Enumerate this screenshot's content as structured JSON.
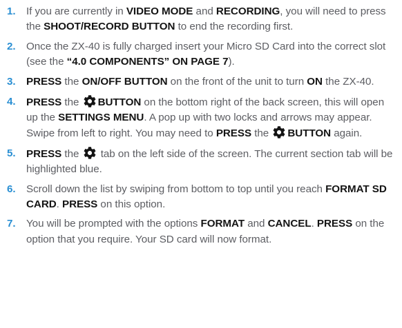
{
  "icons": {
    "settings": "gear-icon"
  },
  "colors": {
    "step_number": "#2a8fd3",
    "body_text": "#5c5d62",
    "bold_text": "#141414"
  },
  "steps": [
    {
      "num": "1.",
      "parts": [
        "If you are currently in ",
        "VIDEO MODE",
        " and ",
        "RECORDING",
        ", you will need to press the ",
        "SHOOT/RECORD BUTTON",
        " to end the recording first."
      ]
    },
    {
      "num": "2.",
      "parts": [
        "Once the ZX-40 is fully charged insert your Micro SD Card into the correct slot (see the ",
        "“4.0 COMPONENTS” ON PAGE 7",
        ")."
      ]
    },
    {
      "num": "3.",
      "parts": [
        "PRESS",
        " the ",
        "ON/OFF BUTTON",
        " on the front of the unit to turn ",
        "ON",
        " the ZX-40."
      ]
    },
    {
      "num": "4.",
      "parts": [
        "PRESS",
        " the ",
        "BUTTON",
        " on the bottom right of the back screen, this will open up the ",
        "SETTINGS MENU",
        ". A pop up with two locks and arrows may appear. Swipe from left to right. You may need to ",
        "PRESS",
        " the ",
        "BUTTON",
        " again."
      ]
    },
    {
      "num": "5.",
      "parts": [
        "PRESS",
        " the ",
        " tab on the left side of the screen. The current section tab will be highlighted blue."
      ]
    },
    {
      "num": "6.",
      "parts": [
        "Scroll down the list by swiping from bottom to top until you reach ",
        "FORMAT SD CARD",
        ". ",
        "PRESS",
        " on this option."
      ]
    },
    {
      "num": "7.",
      "parts": [
        "You will be prompted with the options ",
        "FORMAT",
        " and ",
        "CANCEL",
        ". ",
        "PRESS",
        " on the option that you require. Your SD card will now format."
      ]
    }
  ]
}
